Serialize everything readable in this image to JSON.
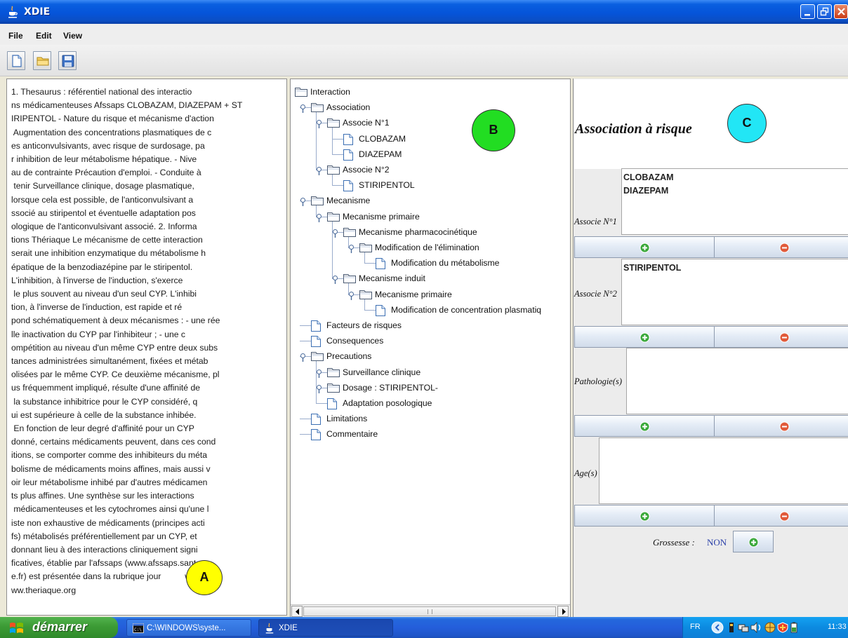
{
  "window": {
    "title": "XDIE"
  },
  "menu": {
    "file": "File",
    "edit": "Edit",
    "view": "View"
  },
  "toolbar": {
    "new": "new-document-icon",
    "open": "open-folder-icon",
    "save": "save-disk-icon"
  },
  "panel_a": {
    "text": "1. Thesaurus : référentiel national des interactio\nns médicamenteuses Afssaps CLOBAZAM, DIAZEPAM + ST\nIRIPENTOL - Nature du risque et mécanisme d'action\n Augmentation des concentrations plasmatiques de c\nes anticonvulsivants, avec risque de surdosage, pa\nr inhibition de leur métabolisme hépatique. - Nive\nau de contrainte Précaution d'emploi. - Conduite à\n tenir Surveillance clinique, dosage plasmatique,\nlorsque cela est possible, de l'anticonvulsivant a\nssocié au stiripentol et éventuelle adaptation pos\nologique de l'anticonvulsivant associé. 2. Informa\ntions Thériaque Le mécanisme de cette interaction\nserait une inhibition enzymatique du métabolisme h\népatique de la benzodiazépine par le stiripentol.\nL'inhibition, à l'inverse de l'induction, s'exerce\n le plus souvent au niveau d'un seul CYP. L'inhibi\ntion, à l'inverse de l'induction, est rapide et ré\npond schématiquement à deux mécanismes : - une rée\nlle inactivation du CYP par l'inhibiteur ; - une c\nompétition au niveau d'un même CYP entre deux subs\ntances administrées simultanément, fixées et métab\nolisées par le même CYP. Ce deuxième mécanisme, pl\nus fréquemment impliqué, résulte d'une affinité de\n la substance inhibitrice pour le CYP considéré, q\nui est supérieure à celle de la substance inhibée.\n En fonction de leur degré d'affinité pour un CYP\ndonné, certains médicaments peuvent, dans ces cond\nitions, se comporter comme des inhibiteurs du méta\nbolisme de médicaments moins affines, mais aussi v\noir leur métabolisme inhibé par d'autres médicamen\nts plus affines. Une synthèse sur les interactions\n médicamenteuses et les cytochromes ainsi qu'une l\niste non exhaustive de médicaments (principes acti\nfs) métabolisés préférentiellement par un CYP, et\ndonnant lieu à des interactions cliniquement signi\nficatives, établie par l'afssaps (www.afssaps.sant\ne.fr) est présentée dans la rubrique jour          w\nww.theriaque.org",
    "marker": "A"
  },
  "tree": {
    "marker": "B",
    "nodes": [
      {
        "label": "Interaction",
        "type": "folder"
      },
      {
        "label": "Association",
        "type": "folder"
      },
      {
        "label": "Associe N°1",
        "type": "folder"
      },
      {
        "label": "CLOBAZAM",
        "type": "leaf"
      },
      {
        "label": "DIAZEPAM",
        "type": "leaf"
      },
      {
        "label": "Associe N°2",
        "type": "folder"
      },
      {
        "label": "STIRIPENTOL",
        "type": "leaf"
      },
      {
        "label": "Mecanisme",
        "type": "folder"
      },
      {
        "label": "Mecanisme primaire",
        "type": "folder"
      },
      {
        "label": "Mecanisme pharmacocinétique",
        "type": "folder"
      },
      {
        "label": "Modification de l'élimination",
        "type": "folder"
      },
      {
        "label": "Modification du métabolisme",
        "type": "leaf"
      },
      {
        "label": "Mecanisme induit",
        "type": "folder"
      },
      {
        "label": "Mecanisme primaire",
        "type": "folder"
      },
      {
        "label": "Modification de concentration plasmatiq",
        "type": "leaf"
      },
      {
        "label": "Facteurs de risques",
        "type": "leaf"
      },
      {
        "label": "Consequences",
        "type": "leaf"
      },
      {
        "label": "Precautions",
        "type": "folder"
      },
      {
        "label": "Surveillance clinique",
        "type": "folder"
      },
      {
        "label": "Dosage : STIRIPENTOL-",
        "type": "folder"
      },
      {
        "label": "Adaptation posologique",
        "type": "leaf"
      },
      {
        "label": "Limitations",
        "type": "leaf"
      },
      {
        "label": "Commentaire",
        "type": "leaf"
      }
    ]
  },
  "panel_c": {
    "marker": "C",
    "title": "Association à risque",
    "associe1": {
      "label": "Associe N°1",
      "values": [
        "CLOBAZAM",
        "DIAZEPAM"
      ]
    },
    "associe2": {
      "label": "Associe N°2",
      "values": [
        "STIRIPENTOL"
      ]
    },
    "pathologies": {
      "label": "Pathologie(s)"
    },
    "ages": {
      "label": "Age(s)"
    },
    "grossesse": {
      "label": "Grossesse :",
      "value": "NON"
    }
  },
  "taskbar": {
    "start": "démarrer",
    "tasks": [
      "C:\\WINDOWS\\syste...",
      "XDIE"
    ],
    "lang": "FR",
    "clock": "11:33"
  },
  "colors": {
    "marker_a": "#ffff00",
    "marker_b": "#22dd22",
    "marker_c": "#22e6f5",
    "add": "#3aa83a",
    "remove": "#e05a3a"
  }
}
